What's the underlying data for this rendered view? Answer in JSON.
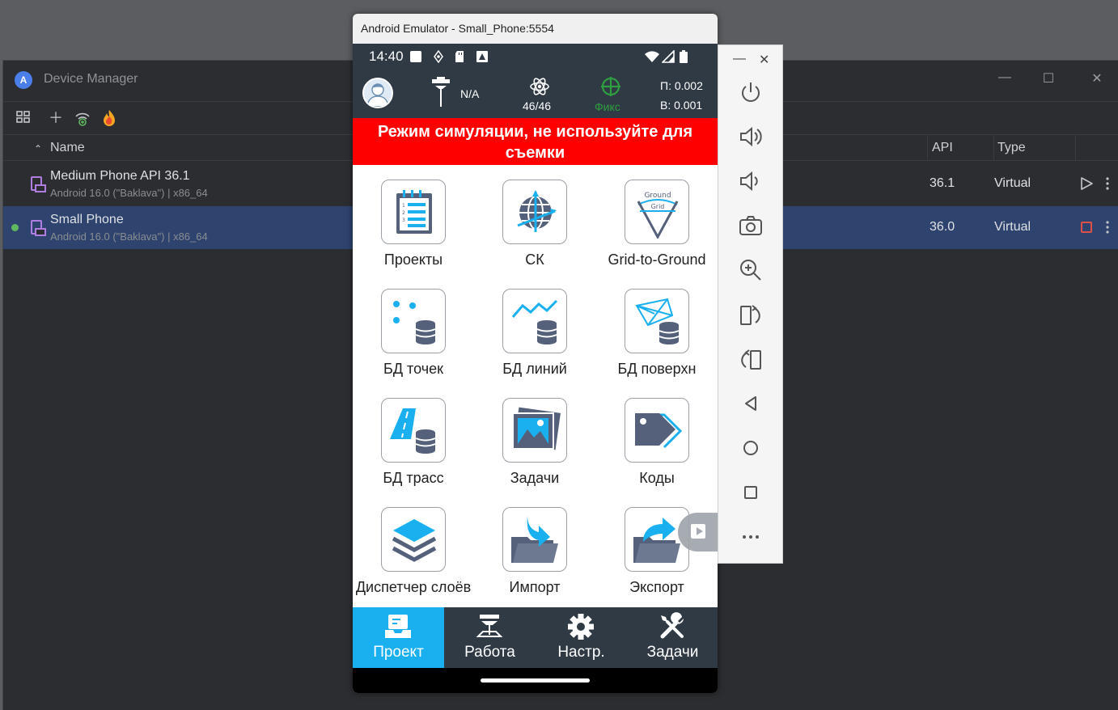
{
  "device_manager": {
    "title": "Device Manager",
    "logo_letter": "A",
    "columns": {
      "name": "Name",
      "api": "API",
      "type": "Type"
    },
    "devices": [
      {
        "name": "Medium Phone API 36.1",
        "subtitle": "Android 16.0 (\"Baklava\") | x86_64",
        "api": "36.1",
        "type": "Virtual",
        "running": false
      },
      {
        "name": "Small Phone",
        "subtitle": "Android 16.0 (\"Baklava\") | x86_64",
        "api": "36.0",
        "type": "Virtual",
        "running": true
      }
    ],
    "toolbar_icons": [
      "device-grid-icon",
      "add-icon",
      "wifi-pairing-icon",
      "firebase-icon"
    ]
  },
  "emulator": {
    "window_title": "Android Emulator - Small_Phone:5554",
    "status_bar": {
      "time": "14:40"
    },
    "app_bar": {
      "receiver_status": "N/A",
      "satellites": "46/46",
      "fix_status": "Фикс",
      "h_precision": "П: 0.002",
      "v_precision": "В: 0.001",
      "fix_color": "#2e9e3e"
    },
    "banner": "Режим симуляции, не используйте для съемки",
    "tiles": [
      {
        "label": "Проекты",
        "icon": "projects-icon"
      },
      {
        "label": "СК",
        "icon": "coordinate-system-icon"
      },
      {
        "label": "Grid-to-Ground",
        "icon": "grid-to-ground-icon",
        "icon_text_top": "Ground",
        "icon_text_bottom": "Grid"
      },
      {
        "label": "БД точек",
        "icon": "points-database-icon"
      },
      {
        "label": "БД линий",
        "icon": "lines-database-icon"
      },
      {
        "label": "БД поверхн",
        "icon": "surfaces-database-icon"
      },
      {
        "label": "БД трасс",
        "icon": "roads-database-icon"
      },
      {
        "label": "Задачи",
        "icon": "tasks-image-icon"
      },
      {
        "label": "Коды",
        "icon": "codes-tag-icon"
      },
      {
        "label": "Диспетчер слоёв",
        "icon": "layers-icon"
      },
      {
        "label": "Импорт",
        "icon": "import-icon"
      },
      {
        "label": "Экспорт",
        "icon": "export-icon"
      }
    ],
    "bottom_nav": [
      {
        "label": "Проект",
        "icon": "project-nav-icon",
        "active": true
      },
      {
        "label": "Работа",
        "icon": "work-nav-icon",
        "active": false
      },
      {
        "label": "Настр.",
        "icon": "settings-nav-icon",
        "active": false
      },
      {
        "label": "Задачи",
        "icon": "tools-nav-icon",
        "active": false
      }
    ],
    "accent_color": "#1ab0ef",
    "bar_color": "#2f3a44",
    "banner_color": "#ff0000"
  },
  "side_toolbar": {
    "buttons": [
      "power-icon",
      "volume-up-icon",
      "volume-down-icon",
      "camera-icon",
      "zoom-icon",
      "rotate-left-icon",
      "rotate-right-icon",
      "back-icon",
      "home-icon",
      "overview-icon",
      "more-icon"
    ]
  }
}
